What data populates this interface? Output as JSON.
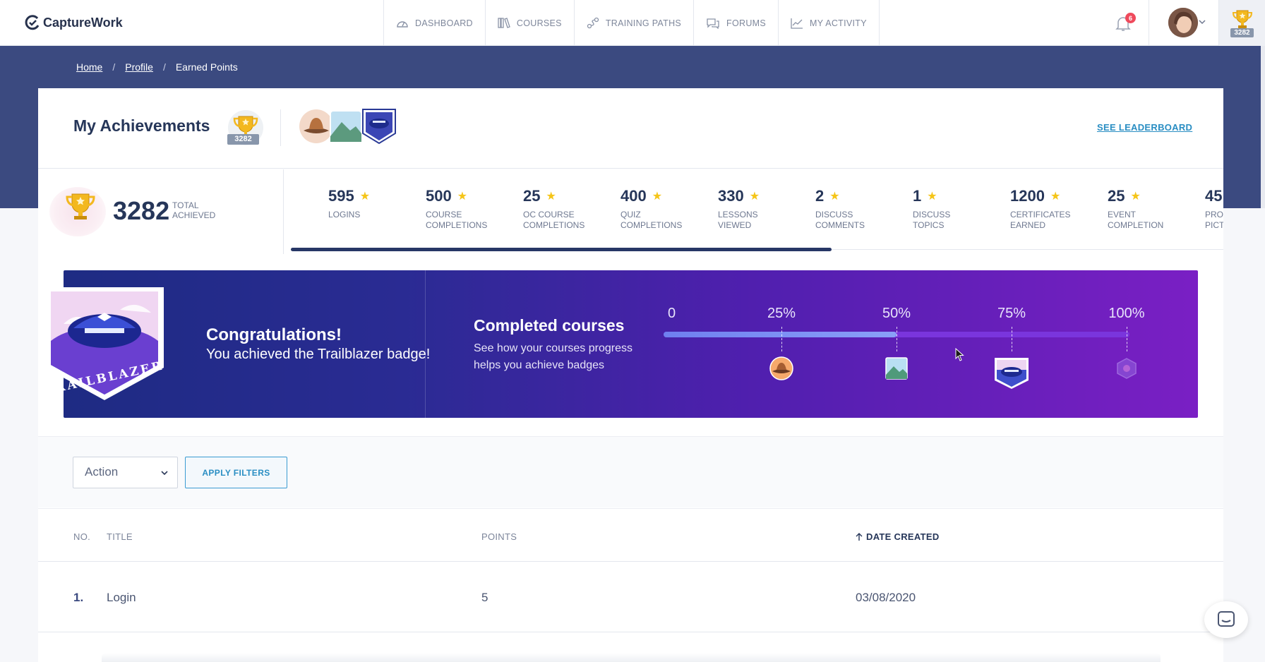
{
  "app": {
    "name": "CaptureWork",
    "brand_color": "#3b4a80",
    "accent": "#2a8ec3"
  },
  "nav": [
    {
      "label": "DASHBOARD",
      "icon": "dashboard-gauge-icon"
    },
    {
      "label": "COURSES",
      "icon": "books-icon"
    },
    {
      "label": "TRAINING PATHS",
      "icon": "path-icon"
    },
    {
      "label": "FORUMS",
      "icon": "chat-bubbles-icon"
    },
    {
      "label": "MY ACTIVITY",
      "icon": "activity-chart-icon"
    }
  ],
  "header": {
    "notifications": "6",
    "points": "3282"
  },
  "breadcrumb": {
    "home": "Home",
    "profile": "Profile",
    "current": "Earned Points",
    "sep": "/"
  },
  "achievements": {
    "title": "My Achievements",
    "points": "3282",
    "leaderboard_link": "SEE LEADERBOARD",
    "total": {
      "value": "3282",
      "label_1": "TOTAL",
      "label_2": "ACHIEVED"
    },
    "stats": [
      {
        "value": "595",
        "label_1": "LOGINS",
        "label_2": ""
      },
      {
        "value": "500",
        "label_1": "COURSE",
        "label_2": "COMPLETIONS"
      },
      {
        "value": "25",
        "label_1": "OC COURSE",
        "label_2": "COMPLETIONS"
      },
      {
        "value": "400",
        "label_1": "QUIZ",
        "label_2": "COMPLETIONS"
      },
      {
        "value": "330",
        "label_1": "LESSONS",
        "label_2": "VIEWED"
      },
      {
        "value": "2",
        "label_1": "DISCUSS",
        "label_2": "COMMENTS"
      },
      {
        "value": "1",
        "label_1": "DISCUSS",
        "label_2": "TOPICS"
      },
      {
        "value": "1200",
        "label_1": "CERTIFICATES",
        "label_2": "EARNED"
      },
      {
        "value": "25",
        "label_1": "EVENT",
        "label_2": "COMPLETION"
      },
      {
        "value": "45",
        "label_1": "PRO",
        "label_2": "PICT"
      }
    ],
    "stats_scroll_fraction": 0.58
  },
  "banner": {
    "congrats_title": "Congratulations!",
    "congrats_sub": "You achieved the Trailblazer badge!",
    "badge_name": "TRAILBLAZER",
    "progress_title": "Completed courses",
    "progress_desc": "See how your courses progress helps you achieve badges",
    "milestones": [
      "0",
      "25%",
      "50%",
      "75%",
      "100%"
    ],
    "progress_fraction": 0.5
  },
  "filters": {
    "action_value": "Action",
    "apply_label": "APPLY FILTERS"
  },
  "table": {
    "headers": {
      "no": "NO.",
      "title": "TITLE",
      "points": "POINTS",
      "date": "DATE CREATED"
    },
    "sort_icon": "arrow-up-icon",
    "rows": [
      {
        "no": "1.",
        "title": "Login",
        "points": "5",
        "date": "03/08/2020"
      }
    ]
  }
}
